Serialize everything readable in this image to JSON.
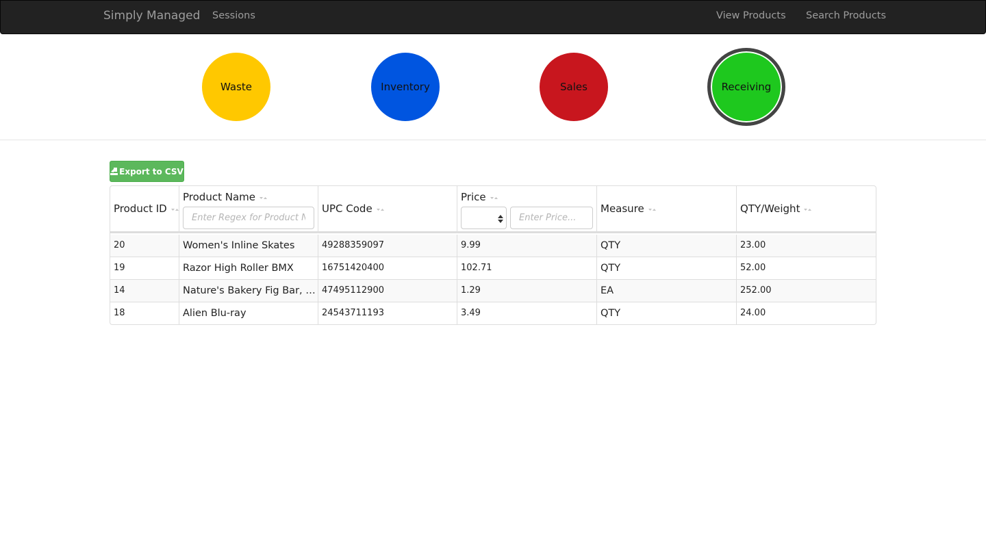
{
  "navbar": {
    "brand": "Simply Managed",
    "sessions": "Sessions",
    "view_products": "View Products",
    "search_products": "Search Products"
  },
  "modes": [
    {
      "label": "Waste",
      "color": "#ffc800"
    },
    {
      "label": "Inventory",
      "color": "#0055e0"
    },
    {
      "label": "Sales",
      "color": "#c8161e"
    },
    {
      "label": "Receiving",
      "color": "#1ec81e",
      "active": true
    }
  ],
  "toolbar": {
    "export_label": "Export to CSV"
  },
  "table": {
    "columns": [
      "Product ID",
      "Product Name",
      "UPC Code",
      "Price",
      "Measure",
      "QTY/Weight"
    ],
    "filters": {
      "name_placeholder": "Enter Regex for Product Name...",
      "price_placeholder": "Enter Price..."
    },
    "rows": [
      [
        "20",
        "Women's Inline Skates",
        "49288359097",
        "9.99",
        "QTY",
        "23.00"
      ],
      [
        "19",
        "Razor High Roller BMX",
        "16751420400",
        "102.71",
        "QTY",
        "52.00"
      ],
      [
        "14",
        "Nature's Bakery Fig Bar, Blueberry",
        "47495112900",
        "1.29",
        "EA",
        "252.00"
      ],
      [
        "18",
        "Alien Blu-ray",
        "24543711193",
        "3.49",
        "QTY",
        "24.00"
      ]
    ]
  }
}
